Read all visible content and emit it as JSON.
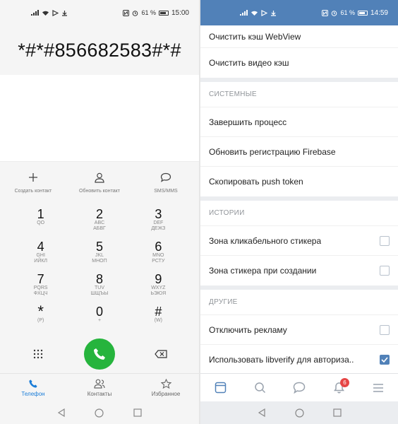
{
  "left": {
    "status": {
      "battery": "61 %",
      "time": "15:00"
    },
    "dialer": {
      "number": "*#*#856682583#*#"
    },
    "actions": [
      {
        "label": "Создать контакт"
      },
      {
        "label": "Обновить контакт"
      },
      {
        "label": "SMS/MMS"
      }
    ],
    "keypad": [
      {
        "digit": "1",
        "l1": "QO",
        "l2": ""
      },
      {
        "digit": "2",
        "l1": "ABC",
        "l2": "АБВГ"
      },
      {
        "digit": "3",
        "l1": "DEF",
        "l2": "ДЕЖЗ"
      },
      {
        "digit": "4",
        "l1": "GHI",
        "l2": "ИЙКЛ"
      },
      {
        "digit": "5",
        "l1": "JKL",
        "l2": "МНОП"
      },
      {
        "digit": "6",
        "l1": "MNO",
        "l2": "РСТУ"
      },
      {
        "digit": "7",
        "l1": "PQRS",
        "l2": "ФХЦЧ"
      },
      {
        "digit": "8",
        "l1": "TUV",
        "l2": "ШЩЪЫ"
      },
      {
        "digit": "9",
        "l1": "WXYZ",
        "l2": "ЬЭЮЯ"
      },
      {
        "digit": "*",
        "l1": "(P)",
        "l2": ""
      },
      {
        "digit": "0",
        "l1": "+",
        "l2": ""
      },
      {
        "digit": "#",
        "l1": "(W)",
        "l2": ""
      }
    ],
    "nav": [
      {
        "label": "Телефон",
        "active": true
      },
      {
        "label": "Контакты",
        "active": false
      },
      {
        "label": "Избранное",
        "active": false
      }
    ],
    "colors": {
      "call": "#26b43d",
      "active_tab": "#1a7dd8"
    }
  },
  "right": {
    "status": {
      "battery": "61 %",
      "time": "14:59"
    },
    "top_rows": [
      {
        "label": "Очистить кэш WebView"
      },
      {
        "label": "Очистить видео кэш"
      }
    ],
    "sections": [
      {
        "title": "СИСТЕМНЫЕ",
        "rows": [
          {
            "label": "Завершить процесс"
          },
          {
            "label": "Обновить регистрацию Firebase"
          },
          {
            "label": "Скопировать push token"
          }
        ]
      },
      {
        "title": "ИСТОРИИ",
        "rows": [
          {
            "label": "Зона кликабельного стикера",
            "checked": false
          },
          {
            "label": "Зона стикера при создании",
            "checked": false
          }
        ]
      },
      {
        "title": "ДРУГИЕ",
        "rows": [
          {
            "label": "Отключить рекламу",
            "checked": false
          },
          {
            "label": "Использовать libverify для авториза..",
            "checked": true
          }
        ]
      }
    ],
    "tabbar": {
      "notifications_badge": "6"
    },
    "colors": {
      "accent": "#5181b8",
      "badge": "#e64646"
    }
  }
}
